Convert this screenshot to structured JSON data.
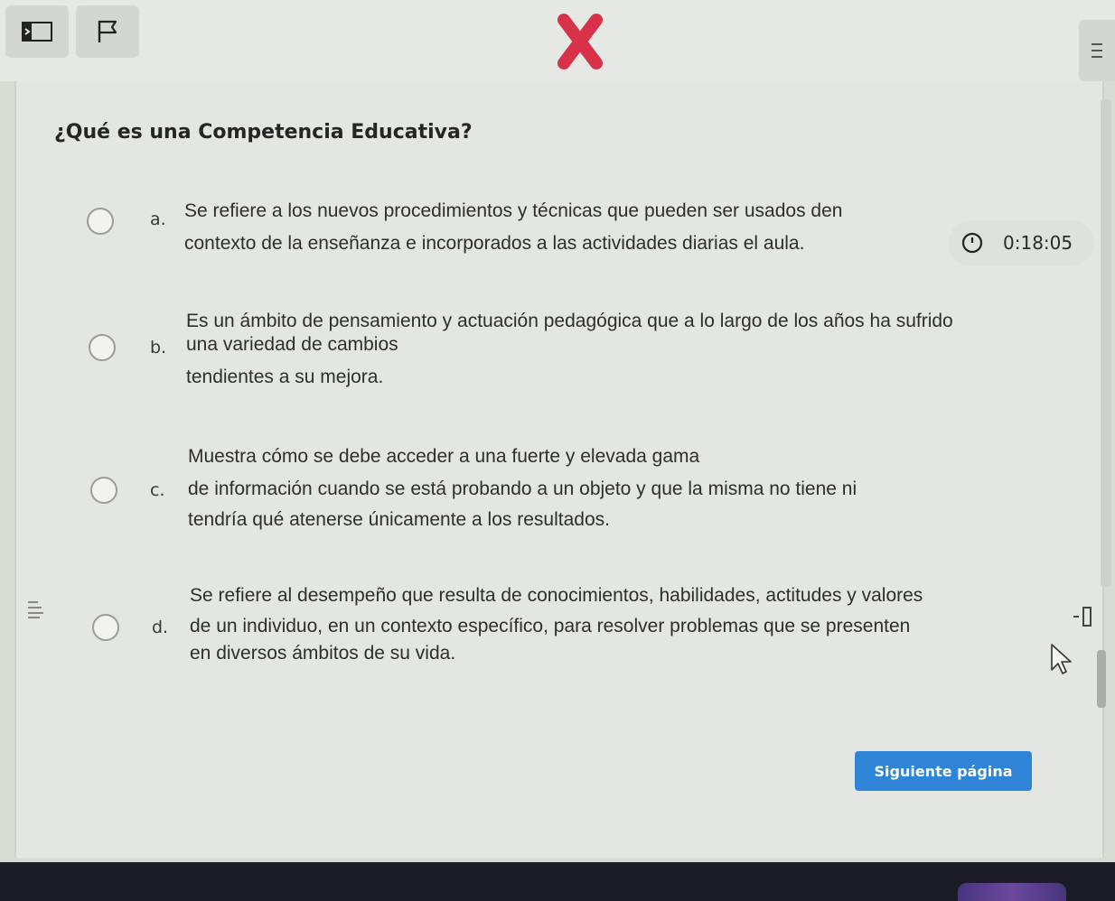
{
  "question": "¿Qué es una Competencia Educativa?",
  "timer": "0:18:05",
  "options": [
    {
      "letter": "a.",
      "lines": [
        "Se refiere a los nuevos procedimientos y técnicas que pueden ser usados den",
        "contexto de la enseñanza e incorporados a las actividades diarias el aula."
      ]
    },
    {
      "letter": "b.",
      "lines": [
        "Es un ámbito de pensamiento y actuación pedagógica que a lo largo de los años ha sufrido",
        "una variedad de cambios",
        "tendientes a su mejora."
      ]
    },
    {
      "letter": "c.",
      "lines": [
        "Muestra cómo se debe acceder a una fuerte y elevada gama",
        "de información cuando se está probando a un objeto y que la misma no tiene ni",
        "tendría qué atenerse únicamente a los resultados."
      ]
    },
    {
      "letter": "d.",
      "lines": [
        "Se refiere al desempeño que resulta de conocimientos, habilidades, actitudes y valores",
        "de un individuo, en un contexto específico, para resolver problemas que se presenten",
        "en diversos ámbitos de su vida."
      ]
    }
  ],
  "next_button": "Siguiente página",
  "colors": {
    "accent": "#2e85d8",
    "close": "#d8324a"
  }
}
